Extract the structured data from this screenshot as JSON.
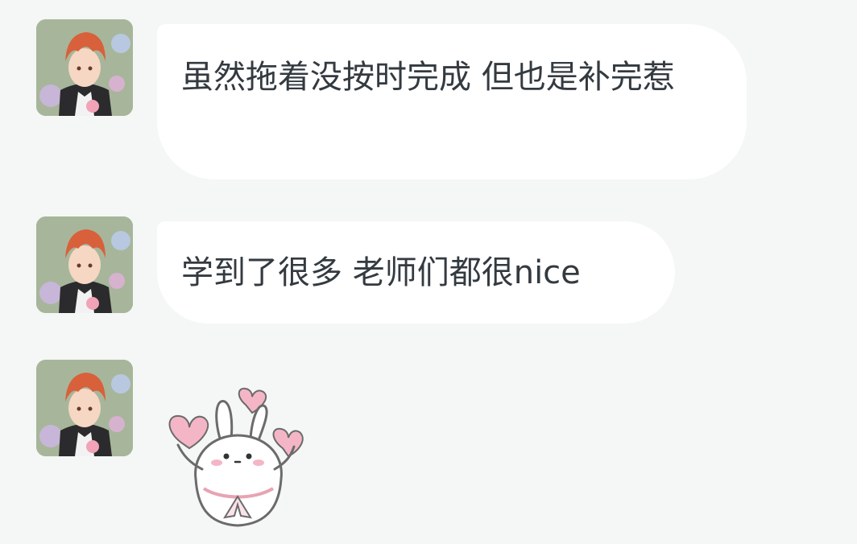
{
  "messages": [
    {
      "type": "text",
      "text": "虽然拖着没按时完成 但也是补完惹",
      "avatar": "anime-avatar-red-hair"
    },
    {
      "type": "text",
      "text": "学到了很多 老师们都很nice",
      "avatar": "anime-avatar-red-hair"
    },
    {
      "type": "sticker",
      "sticker": "bunny-hearts-sticker",
      "avatar": "anime-avatar-red-hair"
    }
  ],
  "colors": {
    "background": "#f5f6f6",
    "bubble": "#ffffff",
    "text": "#333a40",
    "heart": "#f4b6c6",
    "hair": "#d8603b"
  }
}
